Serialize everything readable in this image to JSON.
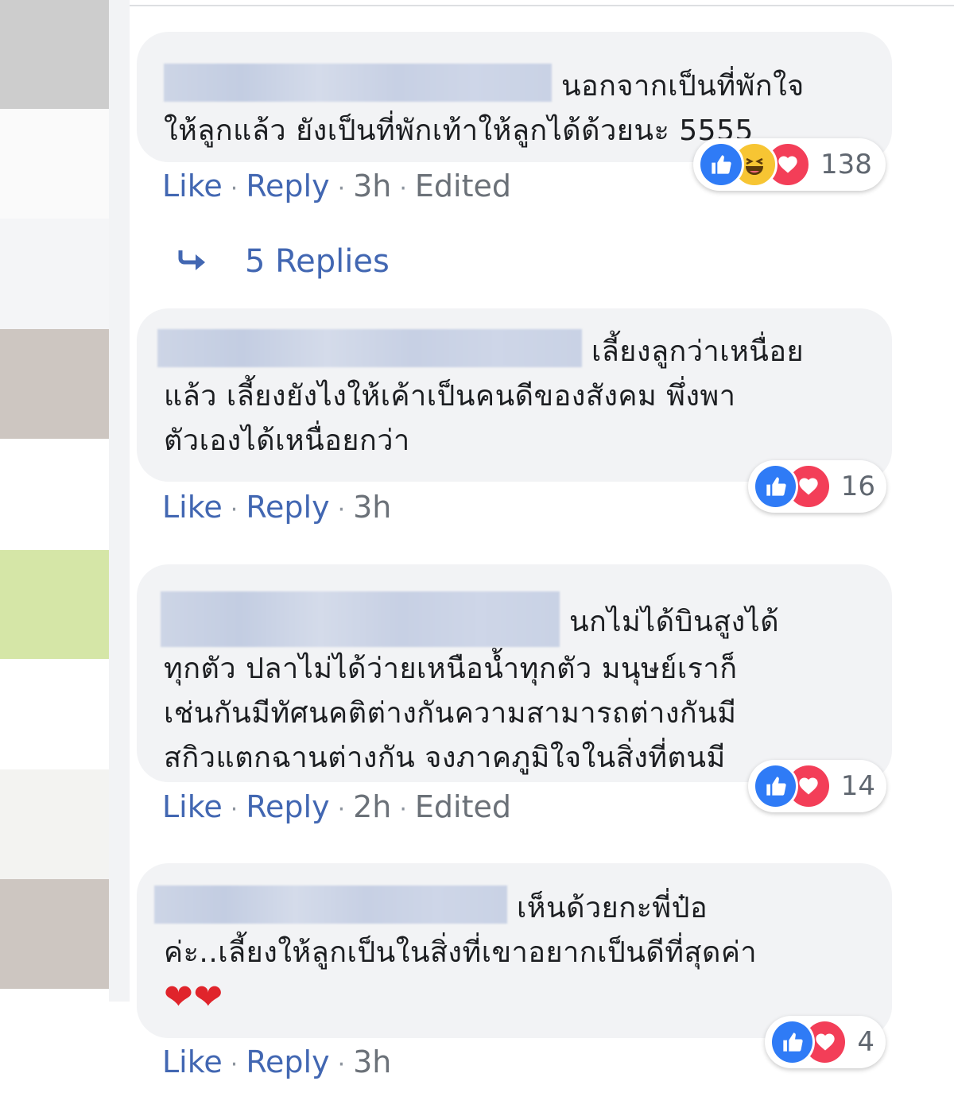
{
  "comments": [
    {
      "text": " นอกจากเป็นที่พักใจ\nให้ลูกแล้ว ยังเป็นที่พักเท้าให้ลูกได้ด้วยนะ 5555",
      "actions": {
        "like": "Like",
        "reply": "Reply",
        "time": "3h",
        "edited": "Edited"
      },
      "reactions": {
        "icons": [
          "like-icon",
          "haha-icon",
          "love-icon"
        ],
        "count": "138"
      }
    },
    {
      "text": " เลี้ยงลูกว่าเหนื่อย\nแล้ว เลี้ยงยังไงให้เค้าเป็นคนดีของสังคม พึ่งพา\nตัวเองได้เหนื่อยกว่า",
      "actions": {
        "like": "Like",
        "reply": "Reply",
        "time": "3h"
      },
      "reactions": {
        "icons": [
          "like-icon",
          "love-icon"
        ],
        "count": "16"
      }
    },
    {
      "text": " นกไม่ได้บินสูงได้\nทุกตัว ปลาไม่ได้ว่ายเหนือน้ำทุกตัว มนุษย์เราก็\nเช่นกันมีทัศนคติต่างกันความสามารถต่างกันมี\nสกิวแตกฉานต่างกัน จงภาคภูมิใจในสิ่งที่ตนมี",
      "actions": {
        "like": "Like",
        "reply": "Reply",
        "time": "2h",
        "edited": "Edited"
      },
      "reactions": {
        "icons": [
          "like-icon",
          "love-icon"
        ],
        "count": "14"
      }
    },
    {
      "text": " เห็นด้วยกะพี่ป๋อ\nค่ะ..เลี้ยงให้ลูกเป็นในสิ่งที่เขาอยากเป็นดีที่สุดค่า\n❤❤",
      "actions": {
        "like": "Like",
        "reply": "Reply",
        "time": "3h"
      },
      "reactions": {
        "icons": [
          "like-icon",
          "love-icon"
        ],
        "count": "4"
      }
    }
  ],
  "replies_link": {
    "label": "5 Replies",
    "icon": "reply-arrow-icon"
  },
  "colors": {
    "link": "#4267b2",
    "bubble": "#f2f3f5",
    "like": "#2f7bf6",
    "love": "#f33e58",
    "haha": "#f7c533"
  }
}
